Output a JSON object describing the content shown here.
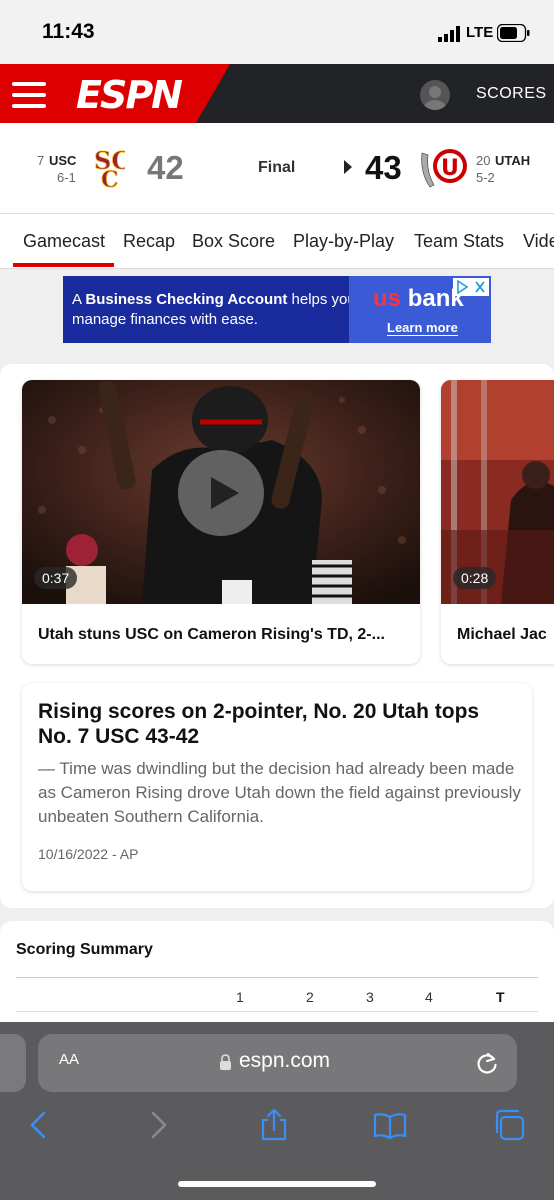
{
  "status_bar": {
    "time": "11:43",
    "network": "LTE"
  },
  "header": {
    "logo": "ESPN",
    "scores_label": "SCORES"
  },
  "game": {
    "away": {
      "rank": "7",
      "abbr": "USC",
      "record": "6-1",
      "score": "42",
      "logo_letters": "SC"
    },
    "home": {
      "rank": "20",
      "abbr": "UTAH",
      "record": "5-2",
      "score": "43",
      "logo_letters": "U"
    },
    "status": "Final"
  },
  "tabs": [
    "Gamecast",
    "Recap",
    "Box Score",
    "Play-by-Play",
    "Team Stats",
    "Vide"
  ],
  "ad": {
    "text_prefix": "A ",
    "text_bold": "Business Checking Account",
    "text_suffix": " helps you manage finances with ease.",
    "brand_us": "us",
    "brand_bank": "bank",
    "cta": "Learn more"
  },
  "videos": [
    {
      "duration": "0:37",
      "title": "Utah stuns USC on Cameron Rising's TD, 2-..."
    },
    {
      "duration": "0:28",
      "title": "Michael Jac"
    }
  ],
  "article": {
    "headline": "Rising scores on 2-pointer, No. 20 Utah tops No. 7 USC 43-42",
    "summary": "— Time was dwindling but the decision had already been made as Cameron Rising drove Utah down the field against previously unbeaten Southern California.",
    "date": "10/16/2022",
    "separator": "-",
    "source": "AP"
  },
  "scoring_summary": {
    "title": "Scoring Summary",
    "columns": [
      "1",
      "2",
      "3",
      "4",
      "T"
    ]
  },
  "browser": {
    "text_size_label": "AA",
    "url": "espn.com"
  },
  "colors": {
    "espn_red": "#dd0000",
    "header_dark": "#222326",
    "usc_cardinal": "#9d2235",
    "usc_gold": "#ffc72c",
    "utah_red": "#cc0000"
  }
}
